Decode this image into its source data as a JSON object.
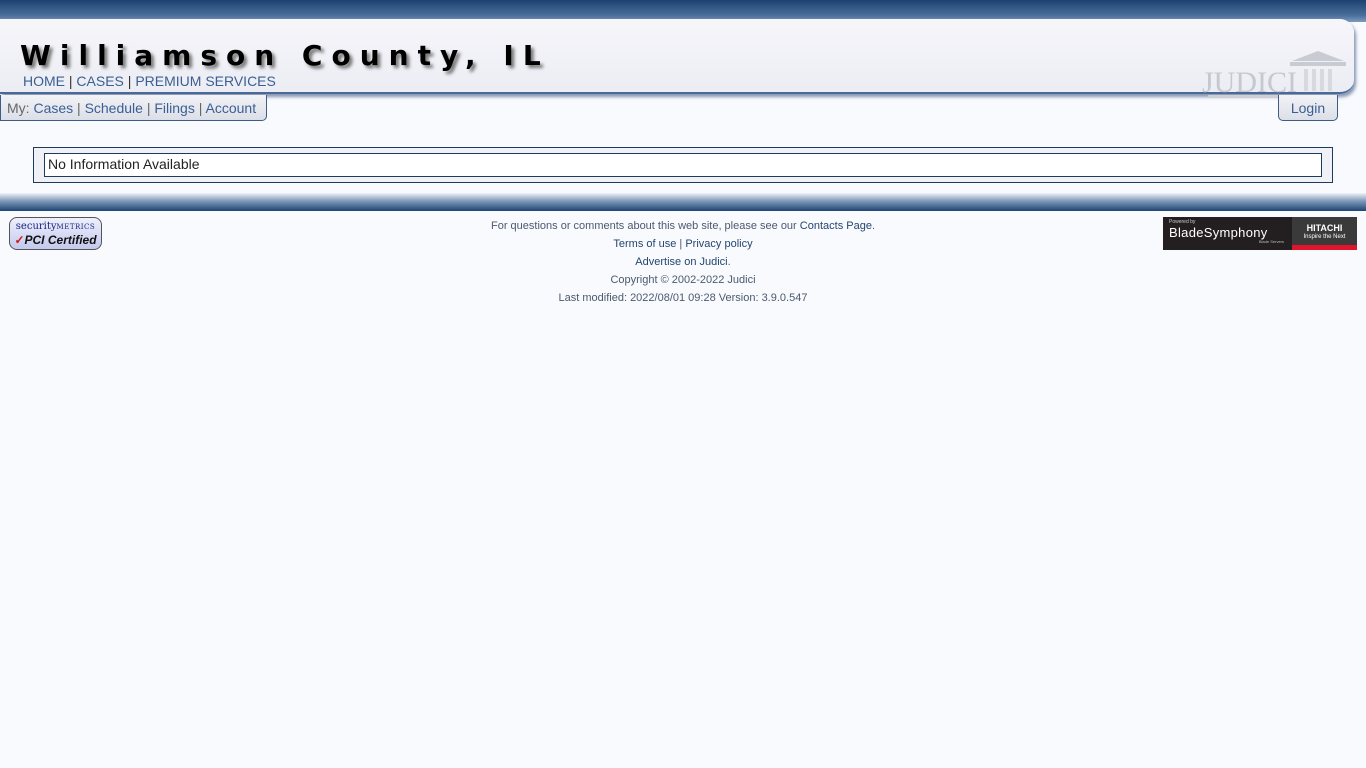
{
  "header": {
    "title": "Williamson County, IL",
    "nav": [
      {
        "label": "HOME"
      },
      {
        "label": "CASES"
      },
      {
        "label": "PREMIUM SERVICES"
      }
    ],
    "separator": "|",
    "logo_text": "JUDICI"
  },
  "mybar": {
    "prefix": "My:",
    "items": [
      {
        "label": "Cases"
      },
      {
        "label": "Schedule"
      },
      {
        "label": "Filings"
      },
      {
        "label": "Account"
      }
    ]
  },
  "login_label": "Login",
  "main": {
    "message": "No Information Available"
  },
  "footer": {
    "questions_text": "For questions or comments about this web site, please see our ",
    "contacts_link": "Contacts Page",
    "period": ".",
    "terms_link": "Terms of use",
    "privacy_link": "Privacy policy",
    "advertise_link": "Advertise on Judici",
    "copyright": "Copyright © 2002-2022 Judici",
    "last_modified": "Last modified: 2022/08/01 09:28 Version: 3.9.0.547"
  },
  "badges": {
    "pci": {
      "top": "security",
      "top_small": "METRICS",
      "check": "✓",
      "bottom": "PCI Certified"
    },
    "blade": {
      "powered": "Powered by",
      "name": "BladeSymphony",
      "sub": "Blade Servers"
    },
    "hitachi": {
      "name": "HITACHI",
      "tagline": "Inspire the Next"
    }
  },
  "colors": {
    "link": "#3b5f93",
    "header_dark": "#1d4272",
    "hitachi_red": "#e0142c"
  }
}
